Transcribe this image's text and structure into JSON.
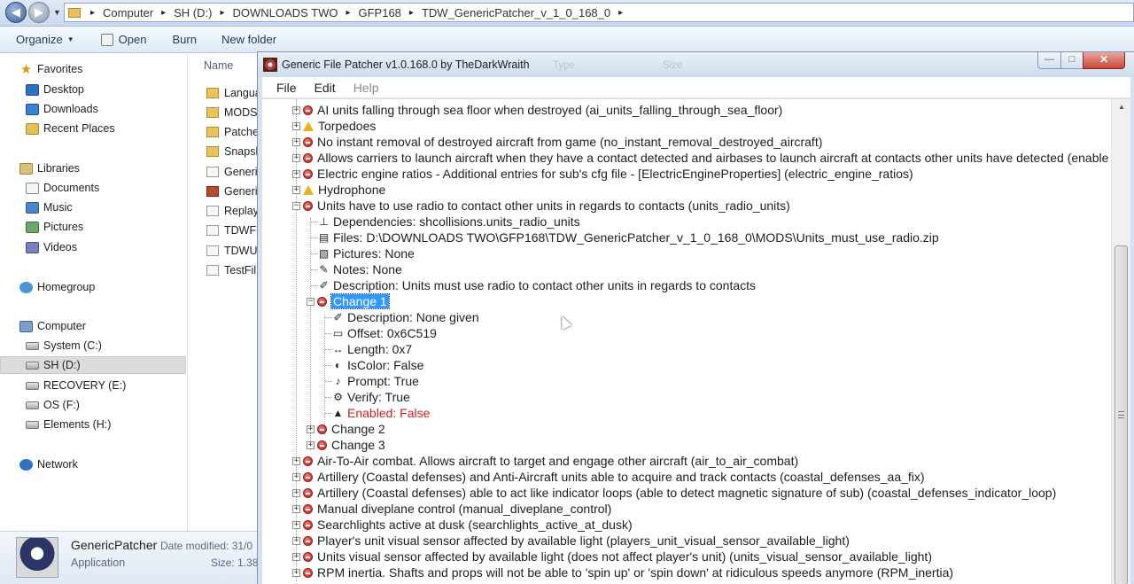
{
  "explorer": {
    "breadcrumbs": [
      "Computer",
      "SH (D:)",
      "DOWNLOADS TWO",
      "GFP168",
      "TDW_GenericPatcher_v_1_0_168_0"
    ],
    "toolbar": {
      "organize": "Organize",
      "open": "Open",
      "burn": "Burn",
      "new_folder": "New folder"
    },
    "nav": {
      "favorites": "Favorites",
      "desktop": "Desktop",
      "downloads": "Downloads",
      "recent_places": "Recent Places",
      "libraries": "Libraries",
      "documents": "Documents",
      "music": "Music",
      "pictures": "Pictures",
      "videos": "Videos",
      "homegroup": "Homegroup",
      "computer": "Computer",
      "drive_c": "System (C:)",
      "drive_d": "SH  (D:)",
      "drive_e": "RECOVERY (E:)",
      "drive_f": "OS (F:)",
      "drive_h": "Elements (H:)",
      "network": "Network"
    },
    "column_header": "Name",
    "files": [
      "Langua",
      "MODS",
      "Patche",
      "Snapsh",
      "Generi",
      "Generi",
      "Replay",
      "TDWFi",
      "TDWU",
      "TestFil"
    ],
    "details": {
      "name": "GenericPatcher",
      "type": "Application",
      "date_modified_label": "Date modified: 31/0",
      "size_label": "Size: 1.38"
    }
  },
  "patcher": {
    "title": "Generic File Patcher v1.0.168.0 by TheDarkWraith",
    "ghost_type": "Type",
    "ghost_size": "Size",
    "window_buttons": {
      "min": "—",
      "max": "□",
      "close": "✕"
    },
    "menu": {
      "file": "File",
      "edit": "Edit",
      "help": "Help"
    },
    "tree": {
      "r1": "AI units falling through sea floor when destroyed  (ai_units_falling_through_sea_floor)",
      "r2": "Torpedoes",
      "r3": "No instant removal of destroyed aircraft from game  (no_instant_removal_destroyed_aircraft)",
      "r4": "Allows carriers to launch aircraft when they have a contact detected and airbases to launch aircraft at contacts other units have detected  (enable",
      "r5": "Electric engine ratios - Additional entries for sub's cfg file - [ElectricEngineProperties]  (electric_engine_ratios)",
      "r6": "Hydrophone",
      "r7": "Units have to use radio to contact other units in regards to contacts  (units_radio_units)",
      "r8": "Dependencies: shcollisions.units_radio_units",
      "r9": "Files: D:\\DOWNLOADS TWO\\GFP168\\TDW_GenericPatcher_v_1_0_168_0\\MODS\\Units_must_use_radio.zip",
      "r10": "Pictures: None",
      "r11": "Notes: None",
      "r12": "Description: Units must use radio to contact other units in regards to contacts",
      "r13": "Change 1",
      "r14": "Description: None given",
      "r15": "Offset: 0x6C519",
      "r16": "Length: 0x7",
      "r17": "IsColor: False",
      "r18": "Prompt: True",
      "r19": "Verify: True",
      "r20": "Enabled: False",
      "r21": "Change 2",
      "r22": "Change 3",
      "r23": "Air-To-Air combat. Allows aircraft to target and engage other aircraft  (air_to_air_combat)",
      "r24": "Artillery (Coastal defenses) and Anti-Aircraft units able to acquire and track contacts  (coastal_defenses_aa_fix)",
      "r25": "Artillery (Coastal defenses) able to act like indicator loops (able to detect magnetic signature of sub)  (coastal_defenses_indicator_loop)",
      "r26": "Manual diveplane control  (manual_diveplane_control)",
      "r27": "Searchlights active at dusk  (searchlights_active_at_dusk)",
      "r28": "Player's unit visual sensor affected by available light  (players_unit_visual_sensor_available_light)",
      "r29": "Units visual sensor affected by available light (does not affect player's unit)  (units_visual_sensor_available_light)",
      "r30": "RPM inertia. Shafts and props will not be able to 'spin up' or 'spin down' at ridiculous speeds anymore  (RPM_inertia)"
    }
  },
  "colors": {
    "selection": "#3399ff",
    "disabled_value": "#cc2222",
    "error_icon": "#c4231a",
    "warning_icon": "#e8b21b"
  }
}
